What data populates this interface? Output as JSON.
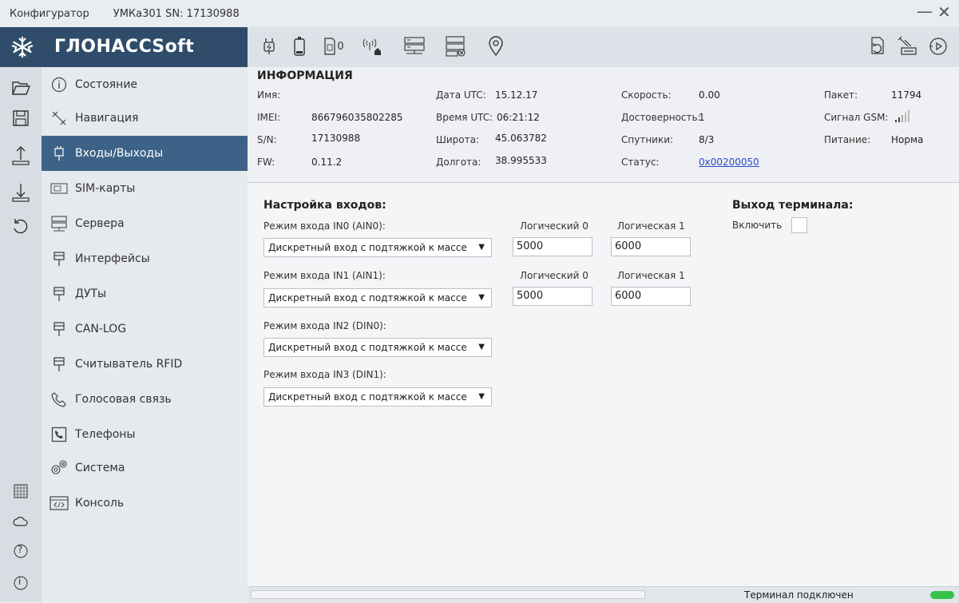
{
  "window": {
    "title": "Конфигуратор",
    "device": "УМКа301 SN: 17130988",
    "minimize_glyph": "—",
    "close_glyph": "✕"
  },
  "brand": {
    "name": "ГЛОНАССSoft",
    "logo_icon": "snowflake-icon"
  },
  "rail": {
    "top_icons": [
      "folder-open-icon",
      "save-icon",
      "upload-icon",
      "download-icon",
      "reset-icon"
    ],
    "bottom_icons": [
      "grid-icon",
      "cloud-icon",
      "help-icon",
      "info-icon"
    ],
    "help_glyph": "?",
    "info_glyph": "i"
  },
  "menu": {
    "items": [
      {
        "label": "Состояние",
        "icon": "info-circle-icon",
        "active": false
      },
      {
        "label": "Навигация",
        "icon": "satellite-icon",
        "active": false
      },
      {
        "label": "Входы/Выходы",
        "icon": "io-plug-icon",
        "active": true
      },
      {
        "label": "SIM-карты",
        "icon": "sim-card-icon",
        "active": false
      },
      {
        "label": "Сервера",
        "icon": "server-icon",
        "active": false
      },
      {
        "label": "Интерфейсы",
        "icon": "connector-icon",
        "active": false
      },
      {
        "label": "ДУТы",
        "icon": "connector-icon",
        "active": false
      },
      {
        "label": "CAN-LOG",
        "icon": "connector-icon",
        "active": false
      },
      {
        "label": "Считыватель RFID",
        "icon": "connector-icon",
        "active": false
      },
      {
        "label": "Голосовая связь",
        "icon": "phone-icon",
        "active": false
      },
      {
        "label": "Телефоны",
        "icon": "phone-book-icon",
        "active": false
      },
      {
        "label": "Система",
        "icon": "gears-icon",
        "active": false
      },
      {
        "label": "Консоль",
        "icon": "console-icon",
        "active": false
      }
    ]
  },
  "toolbar": {
    "left_icons": [
      "power-plug-icon",
      "battery-icon",
      "sim-zero-icon",
      "home-signal-icon",
      "server-add-icon",
      "server-remove-icon",
      "location-pin-icon"
    ],
    "right_icons": [
      "file-refresh-icon",
      "satellite-dish-icon",
      "play-rewind-icon"
    ],
    "sim_label": "0"
  },
  "info": {
    "heading": "ИНФОРМАЦИЯ",
    "col1": [
      {
        "label": "Имя:",
        "value": ""
      },
      {
        "label": "IMEI:",
        "value": "866796035802285"
      },
      {
        "label": "S/N:",
        "value": "17130988"
      },
      {
        "label": "FW:",
        "value": "0.11.2"
      }
    ],
    "col2": [
      {
        "label": "Дата UTC:",
        "value": "15.12.17"
      },
      {
        "label": "Время UTC:",
        "value": "06:21:12"
      },
      {
        "label": "Широта:",
        "value": "45.063782"
      },
      {
        "label": "Долгота:",
        "value": "38.995533"
      }
    ],
    "col3": [
      {
        "label": "Скорость:",
        "value": "0.00"
      },
      {
        "label": "Достоверность:",
        "value": "1"
      },
      {
        "label": "Спутники:",
        "value": "8/3"
      },
      {
        "label": "Статус:",
        "value": "0x00200050"
      }
    ],
    "col4": [
      {
        "label": "Пакет:",
        "value": "11794"
      },
      {
        "label": "Сигнал GSM:",
        "value": ""
      },
      {
        "label": "Питание:",
        "value": "Норма"
      }
    ],
    "gsm_signal_icon": "signal-bars-icon"
  },
  "inputs_section": {
    "title": "Настройка входов:",
    "logical0_label": "Логический 0",
    "logical1_label": "Логическая 1",
    "rows": [
      {
        "label": "Режим входа IN0 (AIN0):",
        "mode": "Дискретный вход с подтяжкой к массе",
        "logical0": "5000",
        "logical1": "6000",
        "has_thresholds": true
      },
      {
        "label": "Режим входа IN1 (AIN1):",
        "mode": "Дискретный вход с подтяжкой к массе",
        "logical0": "5000",
        "logical1": "6000",
        "has_thresholds": true
      },
      {
        "label": "Режим входа IN2 (DIN0):",
        "mode": "Дискретный вход с подтяжкой к массе",
        "has_thresholds": false
      },
      {
        "label": "Режим входа IN3 (DIN1):",
        "mode": "Дискретный вход с подтяжкой к массе",
        "has_thresholds": false
      }
    ],
    "dropdown_arrow": "▼"
  },
  "output_section": {
    "title": "Выход терминала:",
    "enable_label": "Включить",
    "enabled": false
  },
  "statusbar": {
    "text": "Терминал подключен",
    "indicator_color": "#37c24a"
  },
  "colors": {
    "brand_bg": "#2f4d6a",
    "active_item_bg": "#3d6287",
    "link": "#2a49c9"
  }
}
